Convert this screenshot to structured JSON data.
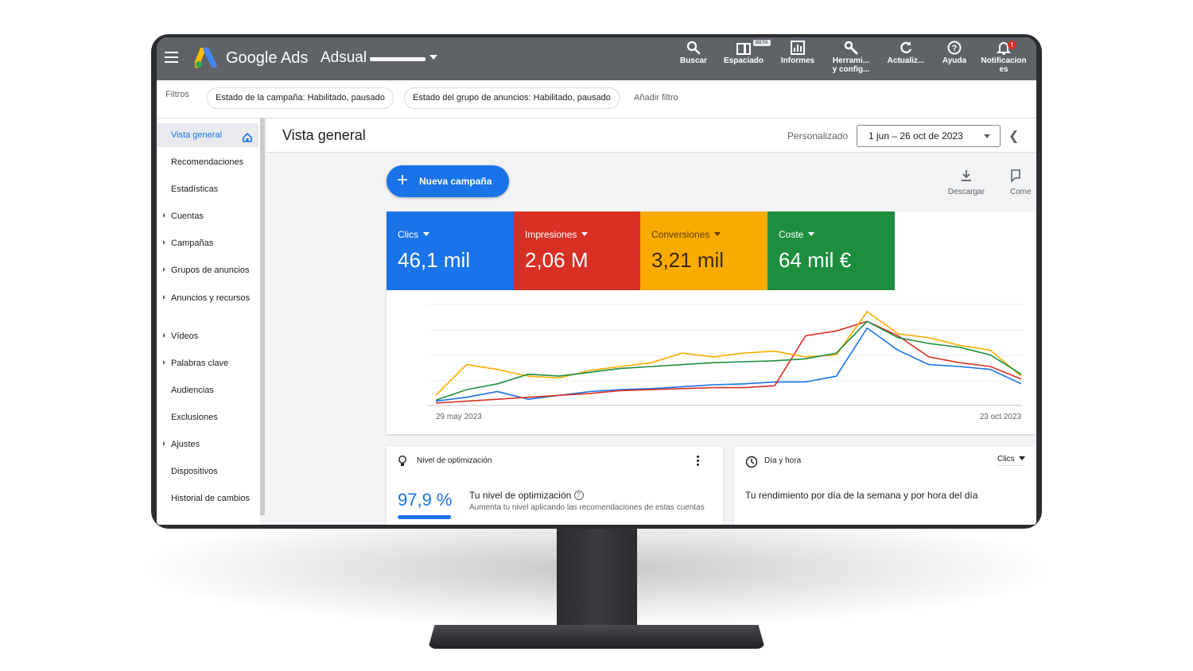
{
  "topbar": {
    "brand": "Google Ads",
    "account": "Adsual",
    "tools": [
      {
        "label": "Buscar",
        "icon": "search-icon"
      },
      {
        "label": "Espaciado",
        "icon": "layout-icon",
        "badge": "BETA"
      },
      {
        "label": "Informes",
        "icon": "reports-icon"
      },
      {
        "label": "Herrami...\ny config...",
        "icon": "wrench-icon"
      },
      {
        "label": "Actualiz...",
        "icon": "refresh-icon"
      },
      {
        "label": "Ayuda",
        "icon": "help-icon"
      },
      {
        "label": "Notificacion\nes",
        "icon": "bell-icon",
        "badge": "!"
      }
    ]
  },
  "filters": {
    "label": "Filtros",
    "chips": [
      "Estado de la campaña: Habilitado, pausado",
      "Estado del grupo de anuncios: Habilitado, pausado"
    ],
    "add": "Añadir filtro"
  },
  "sidebar": {
    "items": [
      {
        "label": "Vista general",
        "active": true,
        "arrow": false
      },
      {
        "label": "Recomendaciones",
        "arrow": false
      },
      {
        "label": "Estadísticas",
        "arrow": false
      },
      {
        "label": "Cuentas",
        "arrow": true
      },
      {
        "label": "Campañas",
        "arrow": true
      },
      {
        "label": "Grupos de anuncios",
        "arrow": true
      },
      {
        "label": "Anuncios y recursos",
        "arrow": true
      },
      {
        "label": "Vídeos",
        "arrow": true
      },
      {
        "label": "Palabras clave",
        "arrow": true
      },
      {
        "label": "Audiencias",
        "arrow": false
      },
      {
        "label": "Exclusiones",
        "arrow": false
      },
      {
        "label": "Ajustes",
        "arrow": true
      },
      {
        "label": "Dispositivos",
        "arrow": false
      },
      {
        "label": "Historial de cambios",
        "arrow": false
      }
    ]
  },
  "main": {
    "title": "Vista general",
    "date_label": "Personalizado",
    "date_range": "1 jun – 26 oct de 2023",
    "new_campaign": "Nueva campaña",
    "download": "Descargar",
    "comments": "Come",
    "metrics": [
      {
        "name": "Clics",
        "value": "46,1 mil",
        "color": "#1a73e8"
      },
      {
        "name": "Impresiones",
        "value": "2,06 M",
        "color": "#d93025"
      },
      {
        "name": "Conversiones",
        "value": "3,21 mil",
        "color": "#f9ab00"
      },
      {
        "name": "Coste",
        "value": "64 mil €",
        "color": "#1e8e3e"
      }
    ]
  },
  "chart_data": {
    "type": "line",
    "x_start_label": "29 may 2023",
    "x_end_label": "23 oct 2023",
    "series": [
      {
        "name": "Clics",
        "color": "#1a73e8",
        "values": [
          2,
          6,
          12,
          4,
          8,
          12,
          14,
          15,
          17,
          19,
          20,
          22,
          22,
          28,
          78,
          55,
          40,
          38,
          35,
          20
        ]
      },
      {
        "name": "Impresiones",
        "color": "#d93025",
        "values": [
          0,
          2,
          4,
          6,
          8,
          10,
          13,
          14,
          15,
          16,
          16,
          18,
          70,
          75,
          85,
          70,
          48,
          42,
          38,
          25
        ]
      },
      {
        "name": "Conversiones",
        "color": "#f9ab00",
        "values": [
          8,
          40,
          35,
          28,
          26,
          34,
          38,
          42,
          52,
          48,
          52,
          54,
          48,
          50,
          95,
          72,
          68,
          60,
          55,
          28
        ]
      },
      {
        "name": "Coste",
        "color": "#1e8e3e",
        "values": [
          3,
          14,
          20,
          30,
          28,
          32,
          36,
          38,
          40,
          42,
          43,
          44,
          46,
          52,
          85,
          68,
          62,
          58,
          50,
          30
        ]
      }
    ]
  },
  "optimization": {
    "title": "Nivel de optimización",
    "value": "97,9 %",
    "level": 0.979,
    "heading": "Tu nivel de optimización",
    "desc": "Aumenta tu nivel aplicando las recomendaciones de estas cuentas"
  },
  "dayhour": {
    "title": "Día y hora",
    "metric": "Clics",
    "subtitle": "Tu rendimiento por día de la semana y por hora del día"
  }
}
